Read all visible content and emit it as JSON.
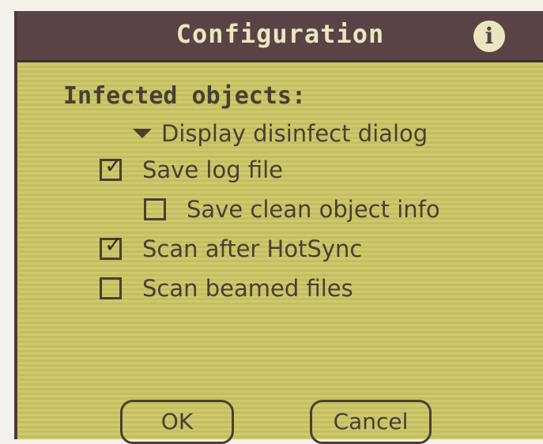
{
  "dialog": {
    "title": "Configuration",
    "info_icon": "i",
    "section_heading": "Infected objects:",
    "popup_trigger": {
      "label": "Display disinfect dialog",
      "icon": "triangle-down-icon"
    },
    "options": [
      {
        "label": "Save log file",
        "checked": true
      },
      {
        "label": "Save clean object info",
        "checked": false
      },
      {
        "label": "Scan after HotSync",
        "checked": true
      },
      {
        "label": "Scan beamed files",
        "checked": false
      }
    ],
    "buttons": {
      "ok": "OK",
      "cancel": "Cancel"
    }
  },
  "colors": {
    "title_bar": "#5a4346",
    "background": "#c8c363",
    "text": "#4a3e34"
  }
}
